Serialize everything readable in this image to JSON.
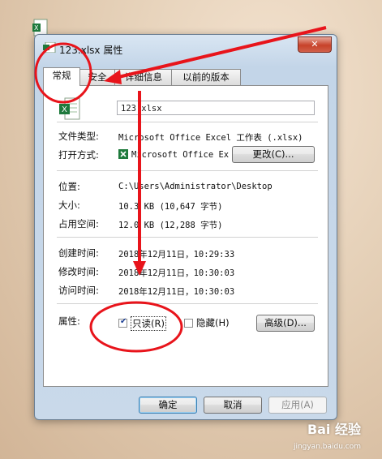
{
  "window": {
    "title": "123.xlsx 属性",
    "close_label": "✕"
  },
  "tabs": [
    {
      "label": "常规",
      "active": true
    },
    {
      "label": "安全",
      "active": false
    },
    {
      "label": "详细信息",
      "active": false
    },
    {
      "label": "以前的版本",
      "active": false
    }
  ],
  "general": {
    "filename": "123.xlsx",
    "file_type_label": "文件类型:",
    "file_type_value": "Microsoft Office Excel 工作表 (.xlsx)",
    "opens_with_label": "打开方式:",
    "opens_with_value": "Microsoft Office Ex",
    "change_button": "更改(C)...",
    "location_label": "位置:",
    "location_value": "C:\\Users\\Administrator\\Desktop",
    "size_label": "大小:",
    "size_value": "10.3 KB (10,647 字节)",
    "size_on_disk_label": "占用空间:",
    "size_on_disk_value": "12.0 KB (12,288 字节)",
    "created_label": "创建时间:",
    "created_value": "2018年12月11日，10:29:33",
    "modified_label": "修改时间:",
    "modified_value": "2018年12月11日，10:30:03",
    "accessed_label": "访问时间:",
    "accessed_value": "2018年12月11日，10:30:03",
    "attributes_label": "属性:",
    "readonly_label": "只读(R)",
    "readonly_checked": true,
    "hidden_label": "隐藏(H)",
    "hidden_checked": false,
    "advanced_button": "高级(D)..."
  },
  "footer": {
    "ok": "确定",
    "cancel": "取消",
    "apply": "应用(A)"
  },
  "watermark": {
    "brand": "Bai 经验",
    "url": "jingyan.baidu.com"
  },
  "colors": {
    "annotation": "#e8141b",
    "excel_green": "#1e7a3c"
  }
}
